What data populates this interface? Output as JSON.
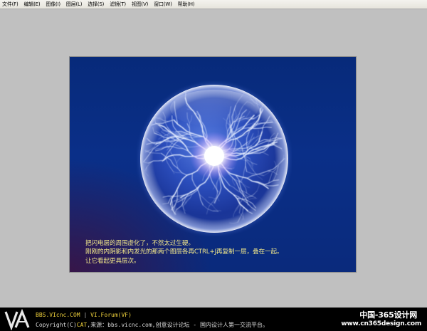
{
  "menubar": {
    "items": [
      {
        "label": "文件(F)"
      },
      {
        "label": "编辑(E)"
      },
      {
        "label": "图像(I)"
      },
      {
        "label": "图层(L)"
      },
      {
        "label": "选择(S)"
      },
      {
        "label": "滤镜(T)"
      },
      {
        "label": "视图(V)"
      },
      {
        "label": "窗口(W)"
      },
      {
        "label": "帮助(H)"
      }
    ]
  },
  "canvas": {
    "caption_lines": [
      "把闪电层的周围虚化了，不然太过生硬。",
      "刚刚的内阴影和内发光的那两个图层各再CTRL+J再复制一层，叠在一起。",
      "让它看起更具层次。"
    ],
    "colors": {
      "background": "#0a2f88",
      "caption": "#f3e88a",
      "orb_glow": "#ffffff",
      "lightning": "#e6eeff"
    }
  },
  "footer": {
    "site": "BBS.VIcnc.COM",
    "separator": "|",
    "forum": "VI.Forum(VF)",
    "copyright_prefix": "Copyright(C)",
    "brand": "CAT",
    "copyright_rest": ",来源：bbs.vicnc.com,创意设计论坛 - 国内设计人第一交流平台。",
    "logo_letters": "VA",
    "watermark_cn": "中国-365设计网",
    "watermark_url": "www.cn365design.com"
  }
}
